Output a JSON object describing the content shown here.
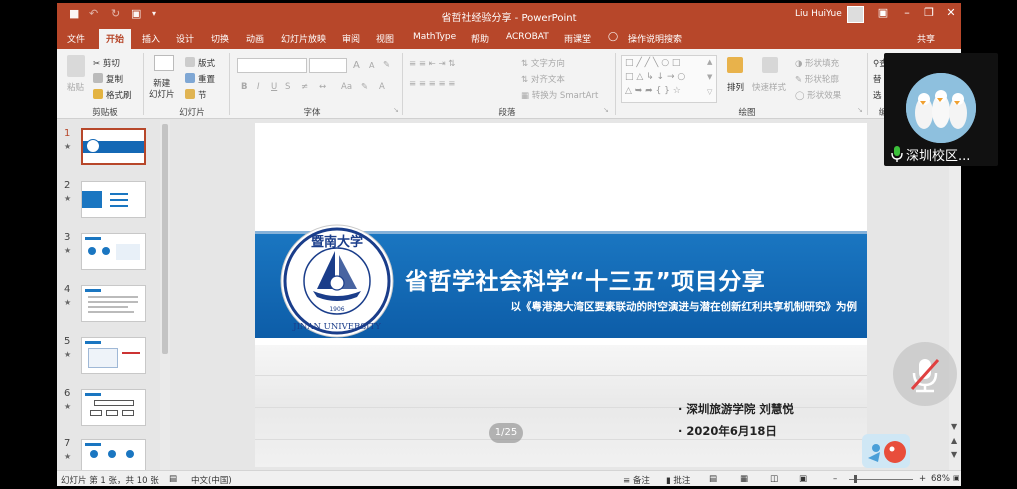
{
  "colors": {
    "brand": "#b7472a",
    "banner_blue": "#1468b5",
    "ribbon": "#f3f3f3"
  },
  "window": {
    "title": "省哲社经验分享  -  PowerPoint",
    "user": "Liu HuiYue"
  },
  "tabs": [
    "文件",
    "开始",
    "插入",
    "设计",
    "切换",
    "动画",
    "幻灯片放映",
    "审阅",
    "视图",
    "MathType",
    "帮助",
    "ACROBAT",
    "雨课堂",
    "操作说明搜索",
    "共享"
  ],
  "ribbon": {
    "clipboard": {
      "paste": "粘贴",
      "cut": "剪切",
      "copy": "复制",
      "format_painter": "格式刷",
      "label": "剪贴板"
    },
    "slides": {
      "new_slide": "新建\n幻灯片",
      "layout": "版式",
      "reset": "重置",
      "section": "节",
      "label": "幻灯片"
    },
    "font": {
      "label": "字体",
      "bold": "B",
      "italic": "I",
      "underline": "U",
      "shadow": "S",
      "grow": "A",
      "shrink": "A"
    },
    "paragraph": {
      "text_direction": "文字方向",
      "align_text": "对齐文本",
      "smartart": "转换为 SmartArt",
      "label": "段落"
    },
    "drawing": {
      "arrange": "排列",
      "quick_styles": "快速样式",
      "shape_fill": "形状填充",
      "shape_outline": "形状轮廓",
      "shape_effects": "形状效果",
      "label": "绘图"
    },
    "editing": {
      "find": "查",
      "replace": "替",
      "select": "选",
      "label": "编"
    }
  },
  "thumbnails": [
    {
      "num": "1",
      "selected": true
    },
    {
      "num": "2",
      "selected": false
    },
    {
      "num": "3",
      "selected": false
    },
    {
      "num": "4",
      "selected": false
    },
    {
      "num": "5",
      "selected": false
    },
    {
      "num": "6",
      "selected": false
    },
    {
      "num": "7",
      "selected": false
    }
  ],
  "slide": {
    "title": "省哲学社会科学“十三五”项目分享",
    "subtitle": "以《粤港澳大湾区要素联动的时空演进与潜在创新红利共享机制研究》为例",
    "logo_text_top": "暨南大学",
    "logo_text_bottom": "JINAN UNIVERSITY",
    "logo_year": "1906",
    "school": "·  深圳旅游学院  刘慧悦",
    "date": "·  2020年6月18日",
    "page_indicator": "1/25"
  },
  "status": {
    "slide_info": "幻灯片 第 1 张，共 10 张",
    "language": "中文(中国)",
    "notes": "备注",
    "comments": "批注",
    "zoom": "68%"
  },
  "meeting": {
    "participant_name": "深圳校区..."
  }
}
